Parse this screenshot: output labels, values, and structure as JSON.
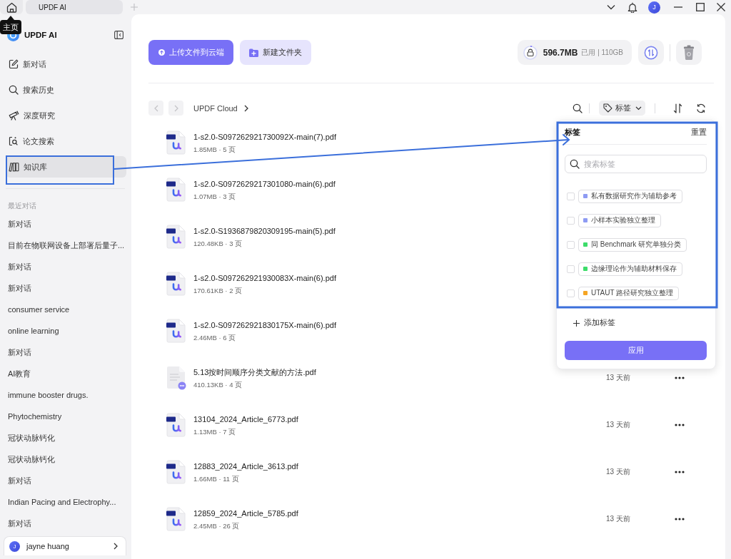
{
  "title_bar": {
    "home_tooltip": "主页",
    "tabs": [
      {
        "label": "UPDF AI",
        "selected": true
      }
    ],
    "avatar": "J"
  },
  "sidebar": {
    "app_name": "UPDF AI",
    "nav": [
      {
        "label": "新对话",
        "selected": false
      },
      {
        "label": "搜索历史",
        "selected": false
      },
      {
        "label": "深度研究",
        "selected": false
      },
      {
        "label": "论文搜索",
        "selected": false
      },
      {
        "label": "知识库",
        "selected": true
      }
    ],
    "recent_heading": "最近对话",
    "recent": [
      "新对话",
      "目前在物联网设备上部署后量子...",
      "新对话",
      "新对话",
      "consumer service",
      "online learning",
      "新对话",
      "AI教育",
      "immune booster drugs.",
      "Phytochemistry",
      "冠状动脉钙化",
      "冠状动脉钙化",
      "新对话",
      "Indian Pacing and Electrophy...",
      "新对话"
    ],
    "user": {
      "avatar": "J",
      "name": "jayne huang"
    }
  },
  "toolbar": {
    "upload": "上传文件到云端",
    "new_folder": "新建文件夹",
    "storage": {
      "used": "596.7MB",
      "note": "已用 | 110GB"
    }
  },
  "path_bar": {
    "breadcrumb": [
      "UPDF Cloud"
    ],
    "filter": "标签"
  },
  "files": [
    {
      "kind": "pdf",
      "name": "1-s2.0-S097262921730092X-main(7).pdf",
      "meta": "1.85MB · 5 页"
    },
    {
      "kind": "pdf",
      "name": "1-s2.0-S0972629217301080-main(6).pdf",
      "meta": "1.07MB · 3 页"
    },
    {
      "kind": "pdf",
      "name": "1-s2.0-S1936879820309195-main(5).pdf",
      "meta": "120.48KB · 3 页"
    },
    {
      "kind": "pdf",
      "name": "1-s2.0-S097262921930083X-main(6).pdf",
      "meta": "170.61KB · 2 页"
    },
    {
      "kind": "pdf",
      "name": "1-s2.0-S097262921830175X-main(6).pdf",
      "meta": "2.46MB · 6 页"
    },
    {
      "kind": "doc",
      "name": "5.13按时间顺序分类文献的方法.pdf",
      "meta": "410.13KB · 4 页",
      "modified": "13 天前"
    },
    {
      "kind": "pdf",
      "name": "13104_2024_Article_6773.pdf",
      "meta": "1.13MB · 7 页",
      "modified": "13 天前"
    },
    {
      "kind": "pdf",
      "name": "12883_2024_Article_3613.pdf",
      "meta": "1.66MB · 11 页",
      "modified": "13 天前"
    },
    {
      "kind": "pdf",
      "name": "12859_2024_Article_5785.pdf",
      "meta": "2.45MB · 26 页",
      "modified": "13 天前"
    }
  ],
  "tag_panel": {
    "title": "标签",
    "reset": "重置",
    "search": {
      "placeholder": "搜索标签"
    },
    "tags": [
      {
        "label": "私有数据研究作为辅助参考",
        "color": "#8e9bf3",
        "checked": false
      },
      {
        "label": "小样本实验独立整理",
        "color": "#8e9bf3",
        "checked": false
      },
      {
        "label": "同 Benchmark 研究单独分类",
        "color": "#3ddc6a",
        "checked": false
      },
      {
        "label": "边缘理论作为辅助材料保存",
        "color": "#3ddc6a",
        "checked": false
      },
      {
        "label": "UTAUT 路径研究独立整理",
        "color": "#f5a524",
        "checked": false
      }
    ],
    "add": "添加标签",
    "apply": "应用"
  },
  "annotations": [
    {
      "kind": "frame"
    },
    {
      "kind": "arrow"
    },
    {
      "kind": "frame"
    }
  ]
}
